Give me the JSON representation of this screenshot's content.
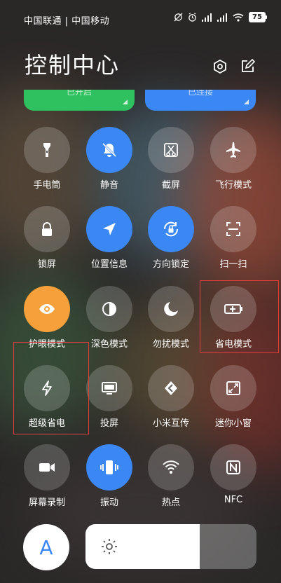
{
  "status_bar": {
    "carrier_text": "中国联通 | 中国移动",
    "battery_level": "75"
  },
  "header": {
    "title": "控制中心",
    "settings_icon": "gear-hexagon-icon",
    "edit_icon": "edit-icon"
  },
  "cards": [
    {
      "label": "已开启",
      "color": "#2fc15f"
    },
    {
      "label": "已连接",
      "color": "#3b87f4"
    }
  ],
  "tiles": [
    {
      "label": "手电筒",
      "icon": "flashlight-icon",
      "active": false
    },
    {
      "label": "静音",
      "icon": "mute-bell-icon",
      "active": true
    },
    {
      "label": "截屏",
      "icon": "screenshot-icon",
      "active": false
    },
    {
      "label": "飞行模式",
      "icon": "airplane-icon",
      "active": false
    },
    {
      "label": "锁屏",
      "icon": "lock-icon",
      "active": false
    },
    {
      "label": "位置信息",
      "icon": "location-icon",
      "active": true
    },
    {
      "label": "方向锁定",
      "icon": "rotation-lock-icon",
      "active": true
    },
    {
      "label": "扫一扫",
      "icon": "scan-icon",
      "active": false
    },
    {
      "label": "护眼模式",
      "icon": "eye-icon",
      "active": true
    },
    {
      "label": "深色模式",
      "icon": "dark-mode-icon",
      "active": false
    },
    {
      "label": "勿扰模式",
      "icon": "moon-icon",
      "active": false
    },
    {
      "label": "省电模式",
      "icon": "battery-saver-icon",
      "active": false
    },
    {
      "label": "超级省电",
      "icon": "lightning-icon",
      "active": false
    },
    {
      "label": "投屏",
      "icon": "cast-screen-icon",
      "active": false
    },
    {
      "label": "小米互传",
      "icon": "mi-share-icon",
      "active": false
    },
    {
      "label": "迷你小窗",
      "icon": "mini-window-icon",
      "active": false
    },
    {
      "label": "屏幕录制",
      "icon": "screen-record-icon",
      "active": false
    },
    {
      "label": "振动",
      "icon": "vibrate-icon",
      "active": true
    },
    {
      "label": "热点",
      "icon": "hotspot-icon",
      "active": false
    },
    {
      "label": "NFC",
      "icon": "nfc-icon",
      "active": false
    }
  ],
  "auto_brightness_label": "A",
  "brightness_level": 0.67,
  "colors": {
    "accent_blue": "#3b87f4",
    "accent_orange": "#f5a03a",
    "highlight_red": "#e53d3d"
  }
}
